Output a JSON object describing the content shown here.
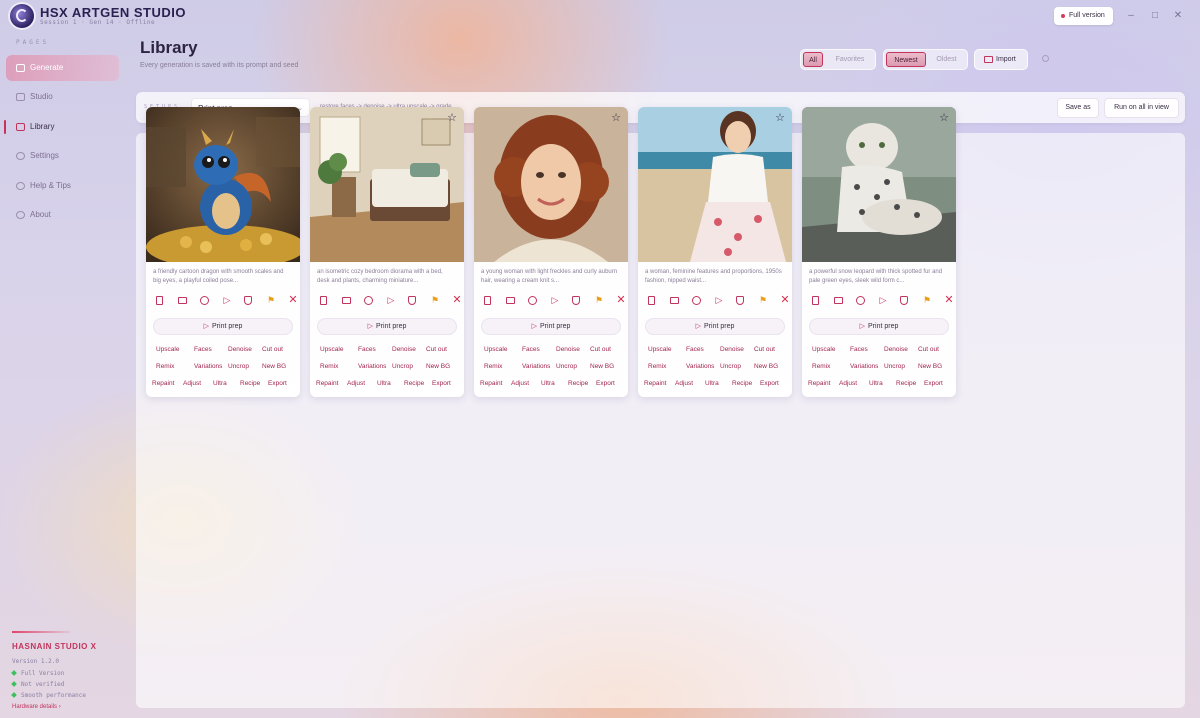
{
  "app": {
    "title": "HSX ARTGEN STUDIO",
    "subtitle": "Session 1 · Gen 14 · Offline",
    "version_badge": "Full version",
    "window_controls": [
      "–",
      "□",
      "✕"
    ]
  },
  "sidebar": {
    "section_label": "PAGES",
    "items": [
      {
        "label": "Generate",
        "icon": "sparkle-icon",
        "state": "highlight"
      },
      {
        "label": "Studio",
        "icon": "image-icon",
        "state": ""
      },
      {
        "label": "Library",
        "icon": "folder-icon",
        "state": "selected"
      },
      {
        "label": "Settings",
        "icon": "gear-icon",
        "state": ""
      },
      {
        "label": "Help & Tips",
        "icon": "help-icon",
        "state": ""
      },
      {
        "label": "About",
        "icon": "info-icon",
        "state": ""
      }
    ],
    "brand": {
      "name": "HASNAIN STUDIO X",
      "version": "Version 1.2.0",
      "status": [
        "Full Version",
        "Not verified",
        "Smooth performance"
      ],
      "hardware_link": "Hardware details ›"
    }
  },
  "library": {
    "title": "Library",
    "subtitle": "Every generation is saved with its prompt and seed",
    "filter_all": "All",
    "filter_favorites": "Favorites",
    "sort_newest": "Newest",
    "sort_oldest": "Oldest",
    "import_label": "Import"
  },
  "toolbar": {
    "setup_label": "SETUPS",
    "setup_value": "Print prep",
    "pipeline": "restore faces -> denoise -> ultra upscale -> grade",
    "save_as": "Save as",
    "run_all": "Run on all in view"
  },
  "card_common": {
    "print_prep": "Print prep",
    "actions": [
      [
        "Upscale",
        "Faces",
        "Denoise",
        "Cut out"
      ],
      [
        "Remix",
        "Variations",
        "Uncrop",
        "New BG"
      ],
      [
        "Repaint",
        "Adjust",
        "Ultra",
        "Recipe",
        "Export"
      ]
    ]
  },
  "cards": [
    {
      "caption": "a friendly cartoon dragon with smooth scales and big eyes, a playful coiled pose...",
      "starred": false
    },
    {
      "caption": "an isometric cozy bedroom diorama with a bed, desk and plants, charming miniature...",
      "starred": true
    },
    {
      "caption": "a young woman with light freckles and curly auburn hair, wearing a cream knit s...",
      "starred": true
    },
    {
      "caption": "a woman, feminine features and proportions, 1950s fashion, nipped waist...",
      "starred": true
    },
    {
      "caption": "a powerful snow leopard with thick spotted fur and pale green eyes, sleek wild form c...",
      "starred": true
    }
  ],
  "colors": {
    "accent": "#c2345c",
    "flag": "#e8a01a",
    "delete": "#d6304f"
  }
}
